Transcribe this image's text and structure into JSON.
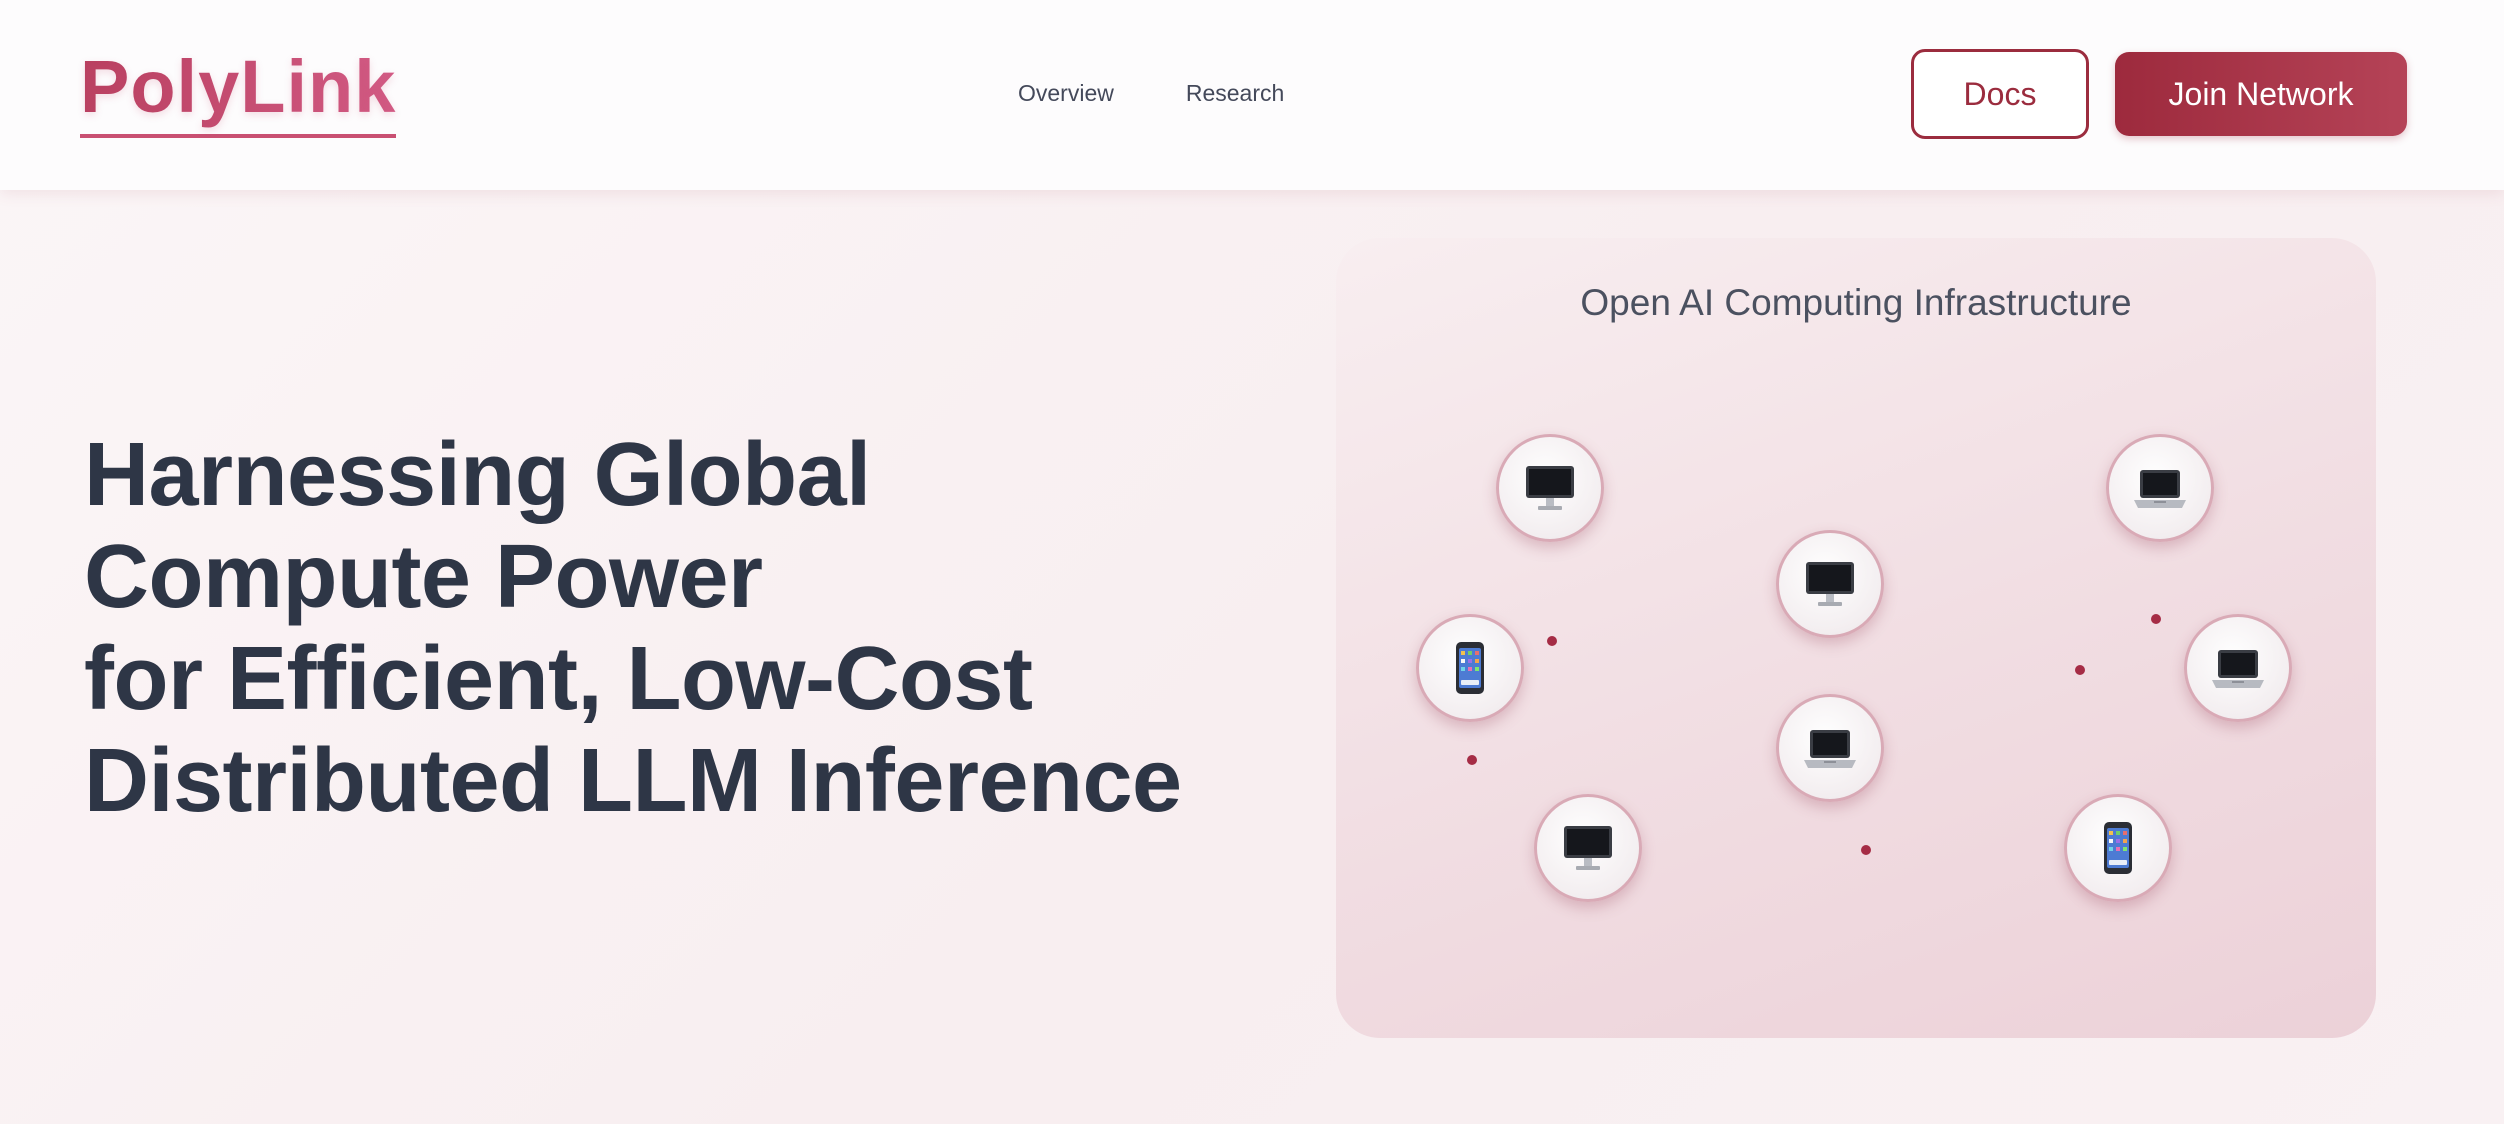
{
  "header": {
    "logo": "PolyLink",
    "nav": [
      {
        "label": "Overview"
      },
      {
        "label": "Research"
      }
    ],
    "docs_label": "Docs",
    "join_label": "Join Network"
  },
  "hero": {
    "title_lines": [
      "Harnessing Global",
      "Compute Power",
      "for Efficient, Low-Cost",
      "Distributed LLM Inference"
    ]
  },
  "network_card": {
    "title": "Open AI Computing Infrastructure",
    "nodes": [
      {
        "device": "desktop-icon"
      },
      {
        "device": "laptop-icon"
      },
      {
        "device": "desktop-icon"
      },
      {
        "device": "phone-icon"
      },
      {
        "device": "laptop-icon"
      },
      {
        "device": "laptop-icon"
      },
      {
        "device": "desktop-icon"
      },
      {
        "device": "phone-icon"
      }
    ]
  },
  "colors": {
    "brand": "#c65378",
    "accent": "#9d2a3d",
    "text_dark": "#2e3646",
    "link_line": "#c9485f"
  }
}
